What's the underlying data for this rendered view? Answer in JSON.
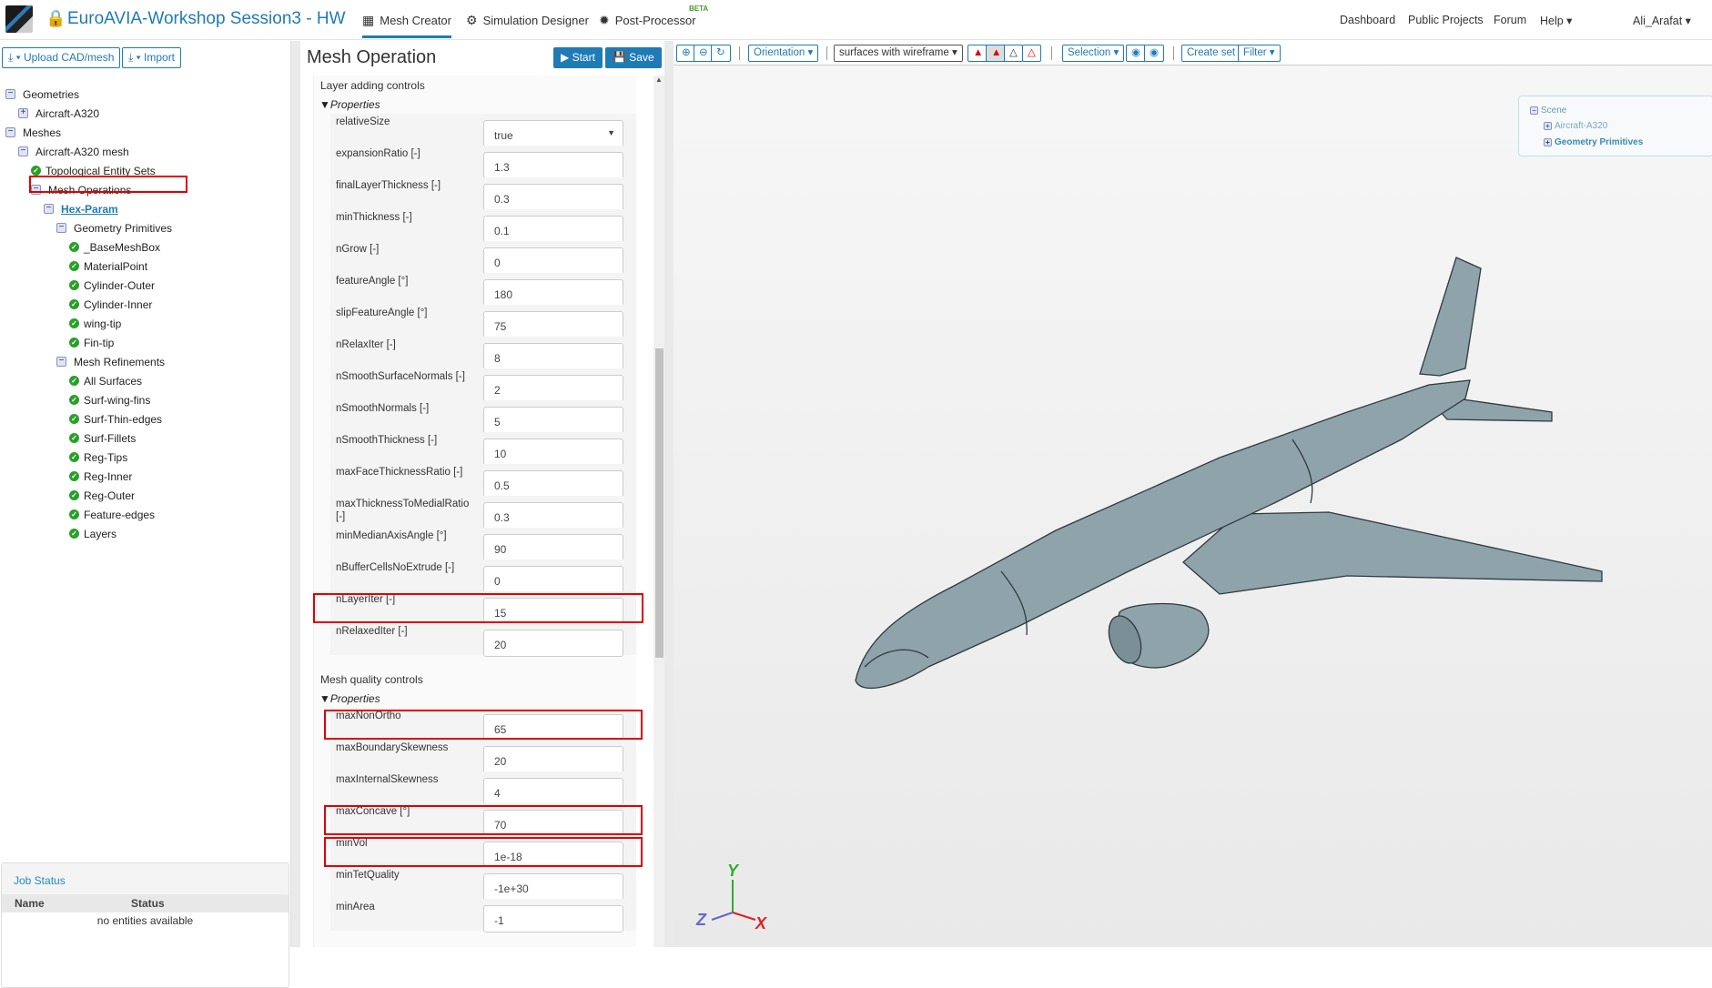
{
  "header": {
    "title": "EuroAVIA-Workshop Session3 - HW",
    "tabs": [
      {
        "label": "Mesh Creator",
        "icon": "grid-icon"
      },
      {
        "label": "Simulation Designer",
        "icon": "gears-icon"
      },
      {
        "label": "Post-Processor",
        "icon": "cog-icon"
      }
    ],
    "beta": "BETA",
    "links": [
      "Dashboard",
      "Public Projects",
      "Forum",
      "Help ▾"
    ],
    "user": "Ali_Arafat ▾"
  },
  "left": {
    "upload": "⤓ ▾ Upload CAD/mesh",
    "import": "⤓ ▾ Import",
    "tree": [
      {
        "label": "Geometries",
        "level": 0,
        "type": "minus"
      },
      {
        "label": "Aircraft-A320",
        "level": 1,
        "type": "plus"
      },
      {
        "label": "Meshes",
        "level": 0,
        "type": "minus"
      },
      {
        "label": "Aircraft-A320 mesh",
        "level": 1,
        "type": "minus"
      },
      {
        "label": "Topological Entity Sets",
        "level": 2,
        "type": "check"
      },
      {
        "label": "Mesh Operations",
        "level": 2,
        "type": "minus"
      },
      {
        "label": " Hex-Param",
        "level": 3,
        "type": "minus",
        "selected": true
      },
      {
        "label": "Geometry Primitives",
        "level": 4,
        "type": "minus"
      },
      {
        "label": "_BaseMeshBox",
        "level": 5,
        "type": "check"
      },
      {
        "label": "MaterialPoint",
        "level": 5,
        "type": "check"
      },
      {
        "label": "Cylinder-Outer",
        "level": 5,
        "type": "check"
      },
      {
        "label": "Cylinder-Inner",
        "level": 5,
        "type": "check"
      },
      {
        "label": "wing-tip",
        "level": 5,
        "type": "check"
      },
      {
        "label": "Fin-tip",
        "level": 5,
        "type": "check"
      },
      {
        "label": "Mesh Refinements",
        "level": 4,
        "type": "minus"
      },
      {
        "label": "All Surfaces",
        "level": 5,
        "type": "check"
      },
      {
        "label": "Surf-wing-fins",
        "level": 5,
        "type": "check"
      },
      {
        "label": "Surf-Thin-edges",
        "level": 5,
        "type": "check"
      },
      {
        "label": "Surf-Fillets",
        "level": 5,
        "type": "check"
      },
      {
        "label": "Reg-Tips",
        "level": 5,
        "type": "check"
      },
      {
        "label": "Reg-Inner",
        "level": 5,
        "type": "check"
      },
      {
        "label": "Reg-Outer",
        "level": 5,
        "type": "check"
      },
      {
        "label": "Feature-edges",
        "level": 5,
        "type": "check"
      },
      {
        "label": "Layers",
        "level": 5,
        "type": "check"
      }
    ],
    "job": {
      "title": "Job Status",
      "col_name": "Name",
      "col_status": "Status",
      "empty": "no entities available"
    }
  },
  "mid": {
    "title": "Mesh Operation",
    "start": "▶ Start",
    "save": "💾 Save",
    "sections": [
      {
        "title": "Layer adding controls",
        "props": "Properties",
        "rows": [
          {
            "label": "relativeSize",
            "value": "true",
            "select": true
          },
          {
            "label": "expansionRatio [-]",
            "value": "1.3"
          },
          {
            "label": "finalLayerThickness [-]",
            "value": "0.3"
          },
          {
            "label": "minThickness [-]",
            "value": "0.1"
          },
          {
            "label": "nGrow [-]",
            "value": "0"
          },
          {
            "label": "featureAngle [°]",
            "value": "180"
          },
          {
            "label": "slipFeatureAngle [°]",
            "value": "75"
          },
          {
            "label": "nRelaxIter [-]",
            "value": "8"
          },
          {
            "label": "nSmoothSurfaceNormals [-]",
            "value": "2"
          },
          {
            "label": "nSmoothNormals [-]",
            "value": "5"
          },
          {
            "label": "nSmoothThickness [-]",
            "value": "10"
          },
          {
            "label": "maxFaceThicknessRatio [-]",
            "value": "0.5"
          },
          {
            "label": "maxThicknessToMedialRatio [-]",
            "value": "0.3"
          },
          {
            "label": "minMedianAxisAngle [°]",
            "value": "90"
          },
          {
            "label": "nBufferCellsNoExtrude [-]",
            "value": "0"
          },
          {
            "label": "nLayerIter [-]",
            "value": "15",
            "highlighted": true
          },
          {
            "label": "nRelaxedIter [-]",
            "value": "20"
          }
        ]
      },
      {
        "title": "Mesh quality controls",
        "props": "Properties",
        "rows": [
          {
            "label": "maxNonOrtho",
            "value": "65",
            "highlighted": true
          },
          {
            "label": "maxBoundarySkewness",
            "value": "20"
          },
          {
            "label": "maxInternalSkewness",
            "value": "4"
          },
          {
            "label": "maxConcave [°]",
            "value": "70",
            "highlighted": true
          },
          {
            "label": "minVol",
            "value": "1e-18",
            "highlighted": true
          },
          {
            "label": "minTetQuality",
            "value": "-1e+30"
          },
          {
            "label": "minArea",
            "value": "-1"
          }
        ]
      }
    ]
  },
  "viewer": {
    "orientation": "Orientation ▾",
    "render_mode": "surfaces with wireframe ▾",
    "selection": "Selection ▾",
    "create_set": "Create set",
    "filter": "Filter ▾",
    "scene": {
      "root": "Scene",
      "items": [
        "Aircraft-A320",
        "Geometry Primitives"
      ]
    },
    "axes": {
      "x": "X",
      "y": "Y",
      "z": "Z"
    },
    "colors": {
      "accent": "#1f7bb6",
      "aircraft": "#8fa3aa",
      "highlight": "#e00000"
    }
  }
}
